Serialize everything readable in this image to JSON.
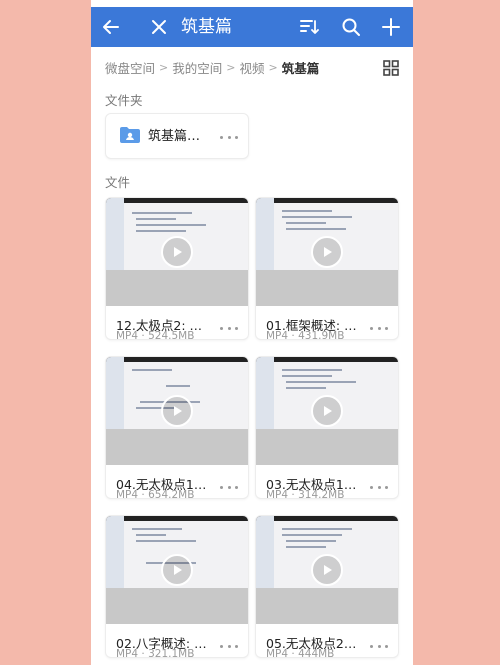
{
  "header": {
    "title": "筑基篇",
    "accent_color": "#3b78d8",
    "icons": [
      "back-arrow-icon",
      "close-icon",
      "sort-icon",
      "search-icon",
      "add-icon"
    ]
  },
  "breadcrumb": {
    "items": [
      "微盘空间",
      "我的空间",
      "视频"
    ],
    "current": "筑基篇",
    "separator": ">"
  },
  "sections": {
    "folders_label": "文件夹",
    "files_label": "文件"
  },
  "folders": [
    {
      "name": "筑基篇…"
    }
  ],
  "files": [
    {
      "name": "12.太极点2: …",
      "meta": "MP4 · 524.5MB"
    },
    {
      "name": "01.框架概述: …",
      "meta": "MP4 · 431.9MB"
    },
    {
      "name": "04.无太极点1…",
      "meta": "MP4 · 654.2MB"
    },
    {
      "name": "03.无太极点1…",
      "meta": "MP4 · 314.2MB"
    },
    {
      "name": "02.八字概述: …",
      "meta": "MP4 · 321.1MB"
    },
    {
      "name": "05.无太极点2…",
      "meta": "MP4 · 444MB"
    }
  ]
}
